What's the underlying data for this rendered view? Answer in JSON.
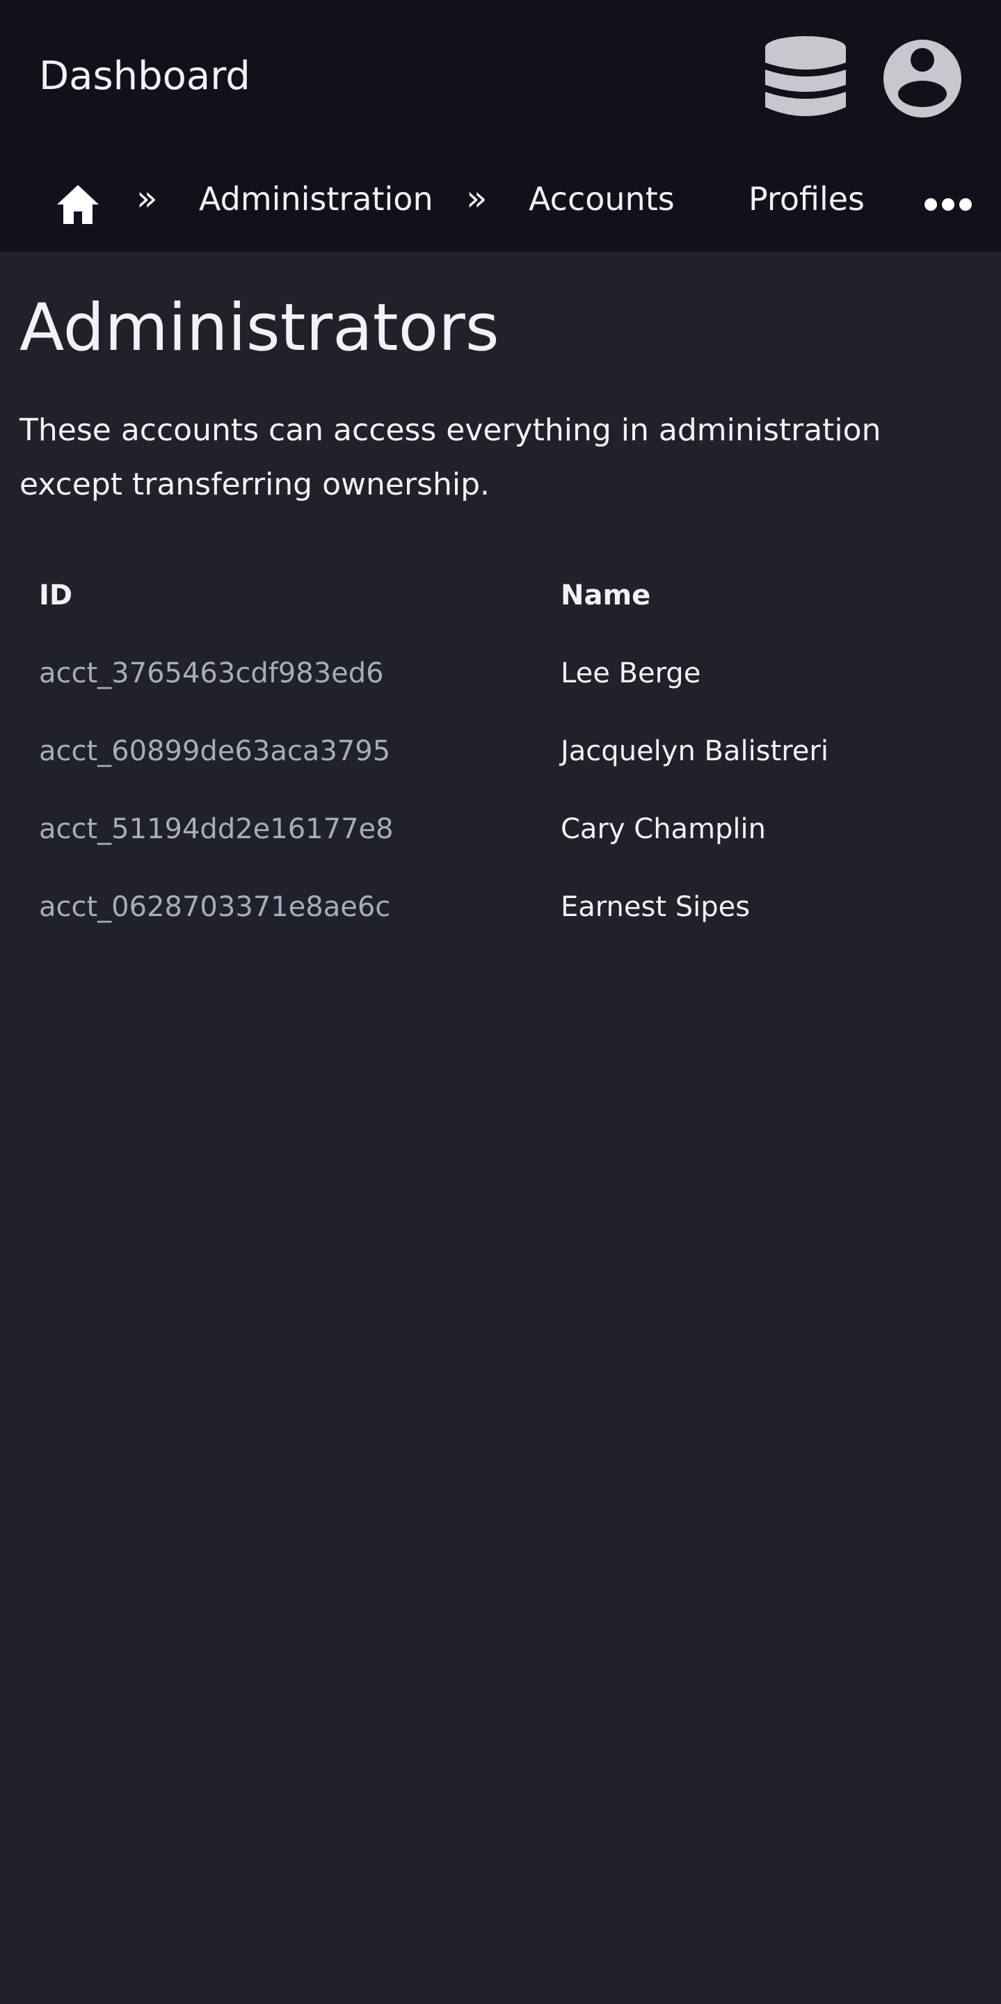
{
  "header": {
    "app_title": "Dashboard",
    "icons": [
      "database-icon",
      "account-circle-icon"
    ]
  },
  "breadcrumb": {
    "home_icon": "home-icon",
    "separator": "»",
    "items": [
      {
        "label": "Administration"
      },
      {
        "label": "Accounts"
      },
      {
        "label": "Profiles"
      }
    ],
    "more_icon": "more-horizontal-icon"
  },
  "page": {
    "title": "Administrators",
    "description": "These accounts can access everything in administration except transferring ownership."
  },
  "table": {
    "columns": [
      "ID",
      "Name"
    ],
    "rows": [
      {
        "id": "acct_3765463cdf983ed6",
        "name": "Lee Berge"
      },
      {
        "id": "acct_60899de63aca3795",
        "name": "Jacquelyn Balistreri"
      },
      {
        "id": "acct_51194dd2e16177e8",
        "name": "Cary Champlin"
      },
      {
        "id": "acct_0628703371e8ae6c",
        "name": "Earnest Sipes"
      }
    ]
  },
  "colors": {
    "header_bg": "#10111b",
    "page_bg": "#20212a",
    "text": "#f2f2f4",
    "muted_text": "#a6adbd",
    "icon_gray": "#c8c8cc"
  }
}
